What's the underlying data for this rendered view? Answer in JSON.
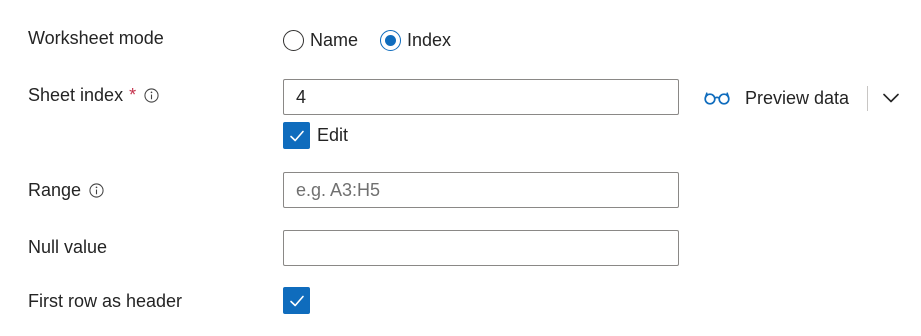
{
  "worksheet_mode": {
    "label": "Worksheet mode",
    "options": [
      {
        "label": "Name",
        "selected": false
      },
      {
        "label": "Index",
        "selected": true
      }
    ]
  },
  "sheet_index": {
    "label": "Sheet index",
    "required_marker": "*",
    "value": "4"
  },
  "edit": {
    "label": "Edit",
    "checked": true
  },
  "preview": {
    "label": "Preview data"
  },
  "range": {
    "label": "Range",
    "value": "",
    "placeholder": "e.g. A3:H5"
  },
  "null_value": {
    "label": "Null value",
    "value": ""
  },
  "first_row_header": {
    "label": "First row as header",
    "checked": true
  },
  "colors": {
    "accent": "#0f6cbd",
    "required": "#c4314b",
    "border": "#8a8886"
  }
}
